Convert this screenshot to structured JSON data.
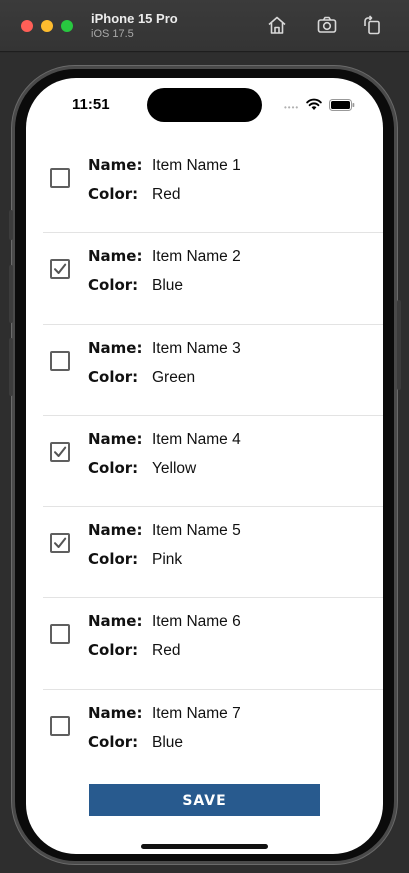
{
  "simulator": {
    "device_name": "iPhone 15 Pro",
    "os_version": "iOS 17.5",
    "toolbar_icons": [
      "home-icon",
      "screenshot-icon",
      "rotate-icon"
    ]
  },
  "status_bar": {
    "time": "11:51"
  },
  "list": {
    "name_label": "Name:",
    "color_label": "Color:",
    "items": [
      {
        "name": "Item Name 1",
        "color": "Red",
        "checked": false
      },
      {
        "name": "Item Name 2",
        "color": "Blue",
        "checked": true
      },
      {
        "name": "Item Name 3",
        "color": "Green",
        "checked": false
      },
      {
        "name": "Item Name 4",
        "color": "Yellow",
        "checked": true
      },
      {
        "name": "Item Name 5",
        "color": "Pink",
        "checked": true
      },
      {
        "name": "Item Name 6",
        "color": "Red",
        "checked": false
      },
      {
        "name": "Item Name 7",
        "color": "Blue",
        "checked": false
      }
    ]
  },
  "save_button": {
    "label": "SAVE",
    "color": "#285a8e"
  }
}
